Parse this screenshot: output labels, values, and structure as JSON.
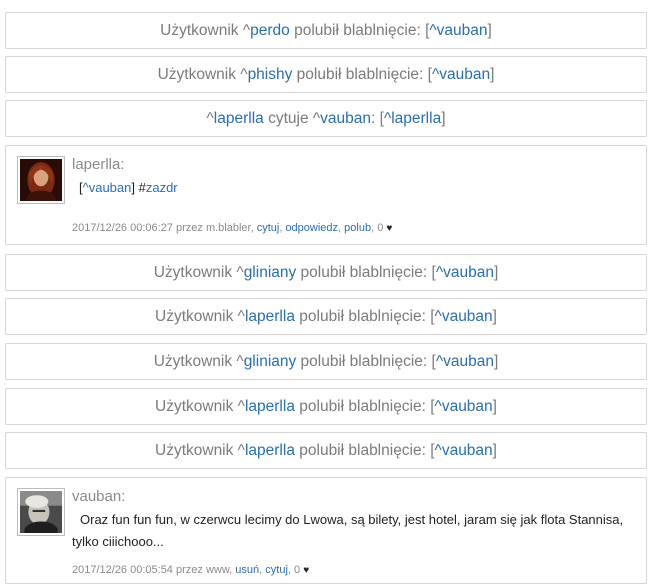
{
  "notices": [
    {
      "prefix": "Użytkownik ^",
      "user": "perdo",
      "mid": " polubił blablnięcie: [",
      "link": "^vauban",
      "suffix": "]"
    },
    {
      "prefix": "Użytkownik ^",
      "user": "phishy",
      "mid": " polubił blablnięcie: [",
      "link": "^vauban",
      "suffix": "]"
    },
    {
      "prefix": "^",
      "user": "laperlla",
      "mid": " cytuje ^",
      "link2": "vauban",
      "mid2": ": [",
      "link": "^laperlla",
      "suffix": "]"
    },
    {
      "prefix": "Użytkownik ^",
      "user": "gliniany",
      "mid": " polubił blablnięcie: [",
      "link": "^vauban",
      "suffix": "]"
    },
    {
      "prefix": "Użytkownik ^",
      "user": "laperlla",
      "mid": " polubił blablnięcie: [",
      "link": "^vauban",
      "suffix": "]"
    },
    {
      "prefix": "Użytkownik ^",
      "user": "gliniany",
      "mid": " polubił blablnięcie: [",
      "link": "^vauban",
      "suffix": "]"
    },
    {
      "prefix": "Użytkownik ^",
      "user": "laperlla",
      "mid": " polubił blablnięcie: [",
      "link": "^vauban",
      "suffix": "]"
    },
    {
      "prefix": "Użytkownik ^",
      "user": "laperlla",
      "mid": " polubił blablnięcie: [",
      "link": "^vauban",
      "suffix": "]"
    }
  ],
  "post1": {
    "author": "laperlla:",
    "open": "[",
    "quote_link": "^vauban",
    "close": "] ",
    "tag_hash": "#",
    "tag": "zazdr",
    "meta_text": "2017/12/26 00:06:27 przez m.blabler, ",
    "cytuj": "cytuj",
    "odpowiedz": "odpowiedz",
    "polub": "polub",
    "likes": ", 0 ",
    "heart": "♥"
  },
  "post2": {
    "author": "vauban:",
    "text": "Oraz fun fun fun, w czerwcu lecimy do Lwowa, są bilety, jest hotel, jaram się jak flota Stannisa, tylko ciiichooo...",
    "meta_text": "2017/12/26 00:05:54 przez www, ",
    "usun": "usuń",
    "cytuj": "cytuj",
    "likes": ", 0 ",
    "heart": "♥"
  },
  "sep": ", "
}
